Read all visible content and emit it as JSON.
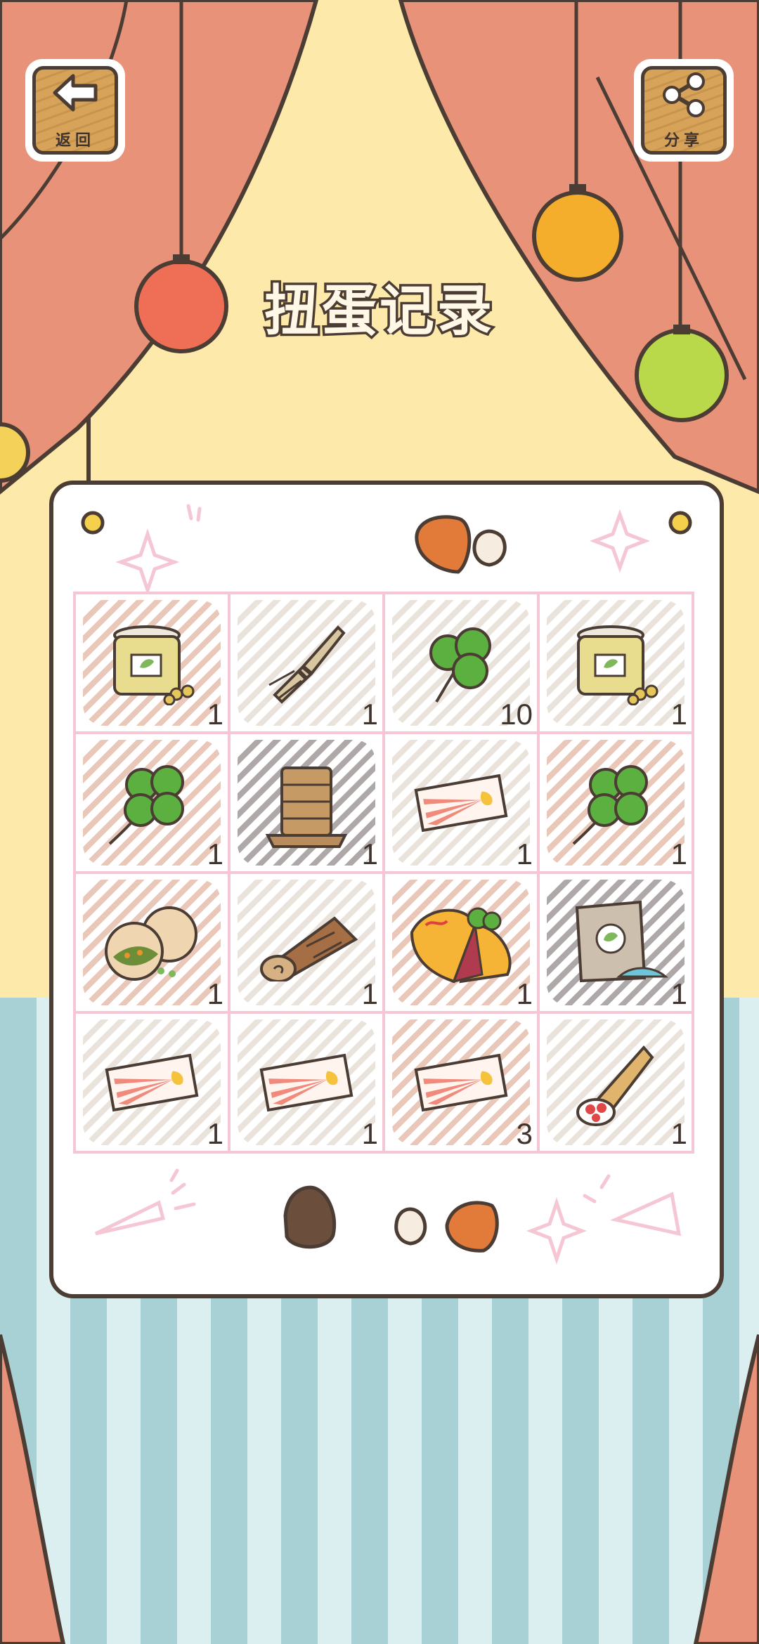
{
  "header": {
    "back_label": "返回",
    "share_label": "分享",
    "title": "扭蛋记录"
  },
  "colors": {
    "curtain": "#e9927a",
    "backdrop": "#fde9a9",
    "stripe_light": "#dbeef0",
    "stripe_dark": "#a8d1d6",
    "outline": "#4b3c34",
    "grid_border": "#f5c6d4"
  },
  "grid": {
    "cells": [
      {
        "item": "jar-of-beans-icon",
        "count": "1",
        "hatch": "#d99a80"
      },
      {
        "item": "dried-herb-bundle-icon",
        "count": "1",
        "hatch": "#d9ccc0"
      },
      {
        "item": "clover-icon",
        "count": "10",
        "hatch": "#d9ccc0"
      },
      {
        "item": "jar-of-beans-icon",
        "count": "1",
        "hatch": "#d9ccc0"
      },
      {
        "item": "four-leaf-clover-icon",
        "count": "1",
        "hatch": "#d99a80"
      },
      {
        "item": "wood-pile-icon",
        "count": "1",
        "hatch": "#6e6060"
      },
      {
        "item": "ticket-icon",
        "count": "1",
        "hatch": "#d9ccc0"
      },
      {
        "item": "four-leaf-clover-icon",
        "count": "1",
        "hatch": "#d99a80"
      },
      {
        "item": "stuffed-buns-icon",
        "count": "1",
        "hatch": "#d99a80"
      },
      {
        "item": "log-icon",
        "count": "1",
        "hatch": "#d9ccc0"
      },
      {
        "item": "omelette-icon",
        "count": "1",
        "hatch": "#d99a80"
      },
      {
        "item": "seed-bag-icon",
        "count": "1",
        "hatch": "#6e6060"
      },
      {
        "item": "ticket-icon",
        "count": "1",
        "hatch": "#d9ccc0"
      },
      {
        "item": "ticket-icon",
        "count": "1",
        "hatch": "#d9ccc0"
      },
      {
        "item": "ticket-icon",
        "count": "3",
        "hatch": "#d99a80"
      },
      {
        "item": "crepe-icon",
        "count": "1",
        "hatch": "#d9ccc0"
      }
    ]
  }
}
